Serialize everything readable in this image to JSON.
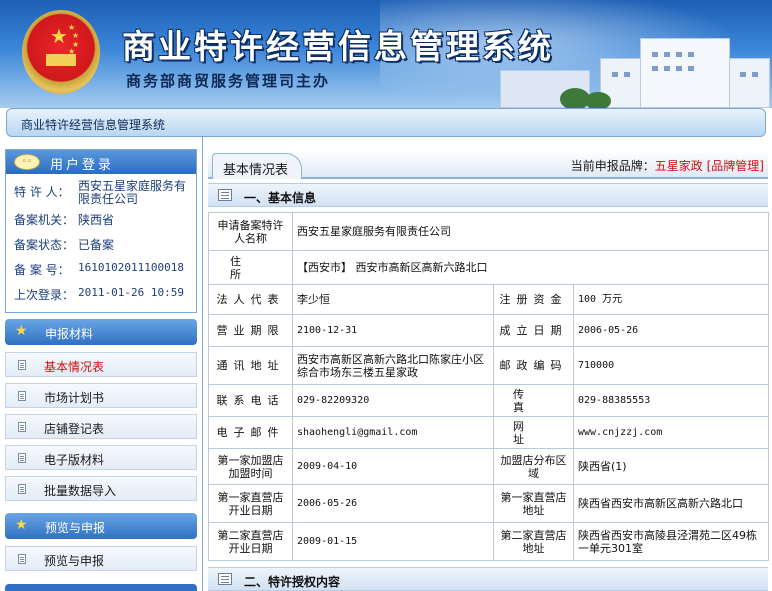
{
  "header": {
    "title": "商业特许经营信息管理系统",
    "subtitle": "商务部商贸服务管理司主办"
  },
  "navbar": {
    "breadcrumb": "商业特许经营信息管理系统"
  },
  "login": {
    "title": "用户登录",
    "rows": [
      {
        "label": "特 许 人：",
        "value": "西安五星家庭服务有限责任公司"
      },
      {
        "label": "备案机关：",
        "value": "陕西省"
      },
      {
        "label": "备案状态：",
        "value": "已备案"
      },
      {
        "label": "备 案 号：",
        "value": "1610102011100018"
      },
      {
        "label": "上次登录：",
        "value": "2011-01-26 10:59"
      }
    ]
  },
  "sidebar": {
    "group1": {
      "title": "申报材料",
      "items": [
        "基本情况表",
        "市场计划书",
        "店铺登记表",
        "电子版材料",
        "批量数据导入"
      ]
    },
    "group2": {
      "title": "预览与申报",
      "items": [
        "预览与申报"
      ]
    },
    "active_item": "基本情况表"
  },
  "main": {
    "tab": "基本情况表",
    "brand_label": "当前申报品牌：",
    "brand_value": "五星家政",
    "brand_link": "[品牌管理]",
    "section1": "一、基本信息",
    "section2": "二、特许授权内容",
    "table": {
      "r1": {
        "label": "申请备案特许人名称",
        "value": "西安五星家庭服务有限责任公司"
      },
      "r2": {
        "label": "住所",
        "value": "【西安市】 西安市高新区高新六路北口"
      },
      "r3": {
        "l1": "法人代表",
        "v1": "李少恒",
        "l2": "注册资金",
        "v2": "100 万元"
      },
      "r4": {
        "l1": "营业期限",
        "v1": "2100-12-31",
        "l2": "成立日期",
        "v2": "2006-05-26"
      },
      "r5": {
        "l1": "通讯地址",
        "v1": "西安市高新区高新六路北口陈家庄小区综合市场东三楼五星家政",
        "l2": "邮政编码",
        "v2": "710000"
      },
      "r6": {
        "l1": "联系电话",
        "v1": "029-82209320",
        "l2": "传真",
        "v2": "029-88385553"
      },
      "r7": {
        "l1": "电子邮件",
        "v1": "shaohengli@gmail.com",
        "l2": "网址",
        "v2": "www.cnjzzj.com"
      },
      "r8": {
        "l1": "第一家加盟店加盟时间",
        "v1": "2009-04-10",
        "l2": "加盟店分布区域",
        "v2": "陕西省(1)"
      },
      "r9": {
        "l1": "第一家直营店开业日期",
        "v1": "2006-05-26",
        "l2": "第一家直营店地址",
        "v2": "陕西省西安市高新区高新六路北口"
      },
      "r10": {
        "l1": "第二家直营店开业日期",
        "v1": "2009-01-15",
        "l2": "第二家直营店地址",
        "v2": "陕西省西安市高陵县泾渭苑二区49栋一单元301室"
      }
    }
  }
}
